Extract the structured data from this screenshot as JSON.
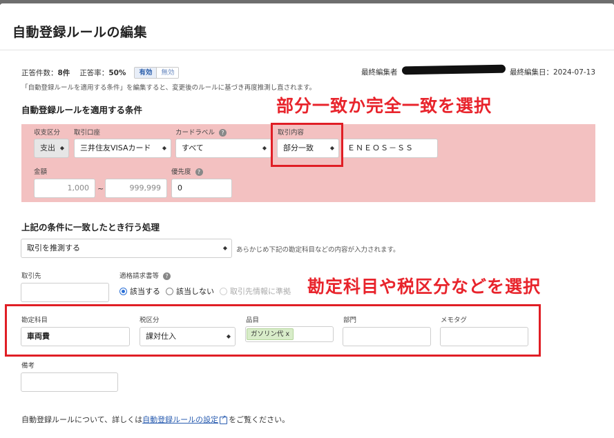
{
  "header": {
    "title": "自動登録ルールの編集"
  },
  "stats": {
    "correct_count_label": "正答件数：",
    "correct_count_value": "8件",
    "correct_rate_label": "正答率：",
    "correct_rate_value": "50%",
    "toggle_on": "有効",
    "toggle_off": "無効",
    "last_editor_label": "最終編集者",
    "last_edit_date_label": "最終編集日：",
    "last_edit_date": "2024-07-13"
  },
  "note": "「自動登録ルールを適用する条件」を編集すると、変更後のルールに基づき再度推測し直されます。",
  "conditions": {
    "heading": "自動登録ルールを適用する条件",
    "income_expense_label": "収支区分",
    "income_expense_value": "支出",
    "account_label": "取引口座",
    "account_value": "三井住友VISAカード",
    "card_label_label": "カードラベル",
    "card_label_value": "すべて",
    "content_label": "取引内容",
    "match_type_value": "部分一致",
    "content_value": "ＥＮＥＯＳ－ＳＳ",
    "amount_label": "金額",
    "amount_min_placeholder": "1,000",
    "amount_max_placeholder": "999,999",
    "priority_label": "優先度",
    "priority_value": "0"
  },
  "action": {
    "heading": "上記の条件に一致したとき行う処理",
    "action_value": "取引を推測する",
    "hint": "あらかじめ下記の勘定科目などの内容が入力されます。",
    "partner_label": "取引先",
    "invoice_label": "適格請求書等",
    "radio_yes": "該当する",
    "radio_no": "該当しない",
    "radio_follow": "取引先情報に準拠",
    "account_item_label": "勘定科目",
    "account_item_value": "車両費",
    "tax_label": "税区分",
    "tax_value": "課対仕入",
    "item_label": "品目",
    "item_tag": "ガソリン代 x",
    "dept_label": "部門",
    "memo_label": "メモタグ",
    "remarks_label": "備考"
  },
  "annotations": {
    "match_note": "部分一致か完全一致を選択",
    "account_note": "勘定科目や税区分などを選択"
  },
  "footer": {
    "text_before": "自動登録ルールについて、詳しくは",
    "link_text": "自動登録ルールの設定",
    "text_after": "をご覧ください。"
  },
  "colors": {
    "highlight_pink": "#f3c1c1",
    "annotation_red": "#e8242c",
    "link_blue": "#2a5db0",
    "tag_green": "#d8ecc9"
  }
}
